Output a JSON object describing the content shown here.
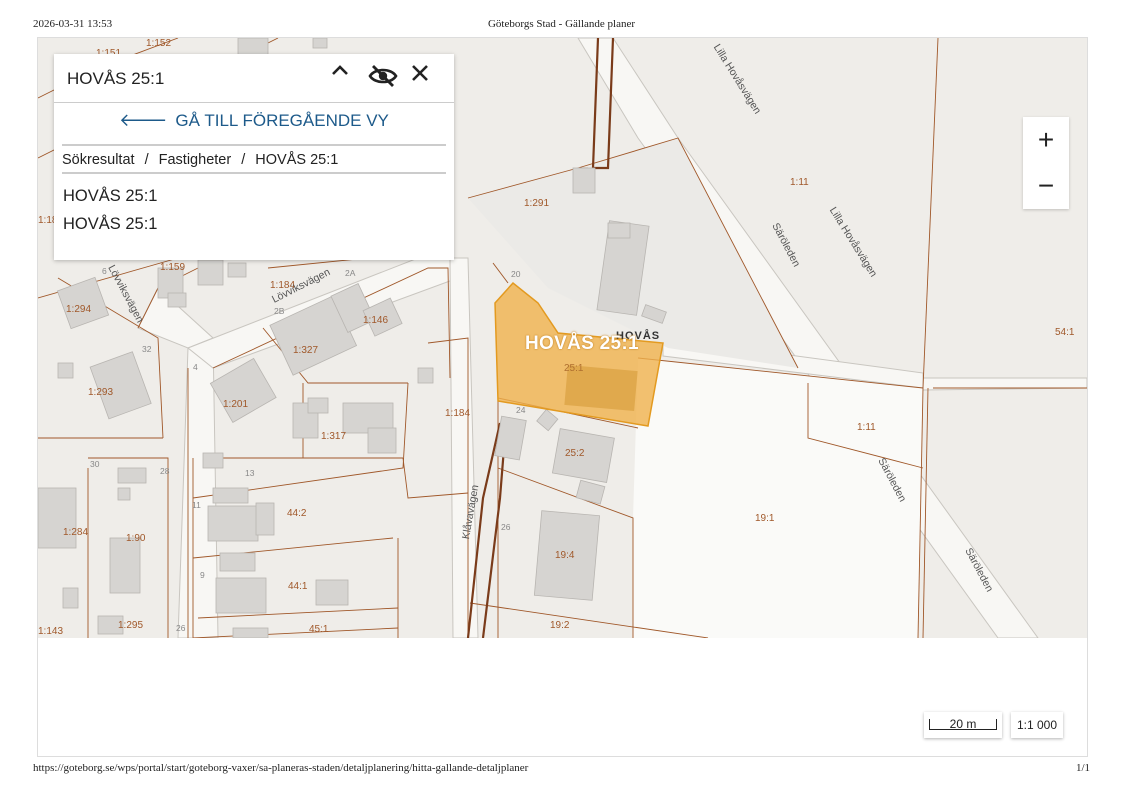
{
  "print": {
    "date": "2026-03-31 13:53",
    "title": "Göteborgs Stad - Gällande planer",
    "url": "https://goteborg.se/wps/portal/start/goteborg-vaxer/sa-planeras-staden/detaljplanering/hitta-gallande-detaljplaner",
    "page": "1/1"
  },
  "panel": {
    "title": "HOVÅS 25:1",
    "collapse_icon": "chevron-up-icon",
    "visibility_icon": "eye-off-icon",
    "close_icon": "close-icon",
    "back_label": "GÅ TILL FÖREGÅENDE VY",
    "breadcrumb": [
      "Sökresultat",
      "Fastigheter",
      "HOVÅS 25:1"
    ],
    "breadcrumb_sep": "/",
    "results": [
      "HOVÅS 25:1",
      "HOVÅS 25:1"
    ]
  },
  "zoom": {
    "in": "+",
    "out": "−"
  },
  "scale": {
    "bar_label": "20 m",
    "ratio": "1:1 000"
  },
  "map": {
    "highlight_label": "HOVÅS 25:1",
    "area_name": "HOVÅS",
    "parcels": [
      "1:152",
      "1:151",
      "1:18",
      "1:159",
      "1:294",
      "1:184",
      "1:146",
      "1:327",
      "1:293",
      "1:201",
      "1:317",
      "1:184",
      "1:284",
      "1:90",
      "44:2",
      "44:1",
      "1:143",
      "1:295",
      "45:1",
      "1:291",
      "25:1",
      "25:2",
      "19:4",
      "19:2",
      "19:1",
      "1:11",
      "1:11",
      "54:1"
    ],
    "numbers": [
      "6",
      "2B",
      "2A",
      "32",
      "4",
      "20",
      "24",
      "30",
      "28",
      "13",
      "11",
      "9",
      "26",
      "26"
    ],
    "streets": [
      "Lövviksvägen",
      "Lövviksvägen",
      "Klåvavägen",
      "Lilla Hovåsvägen",
      "Lilla Hovåsvägen",
      "Säröleden",
      "Säröleden",
      "Säröleden"
    ],
    "colors": {
      "highlight": "#f0b24c",
      "parcel_line": "#a0582a",
      "building": "#d6d4d1"
    }
  }
}
